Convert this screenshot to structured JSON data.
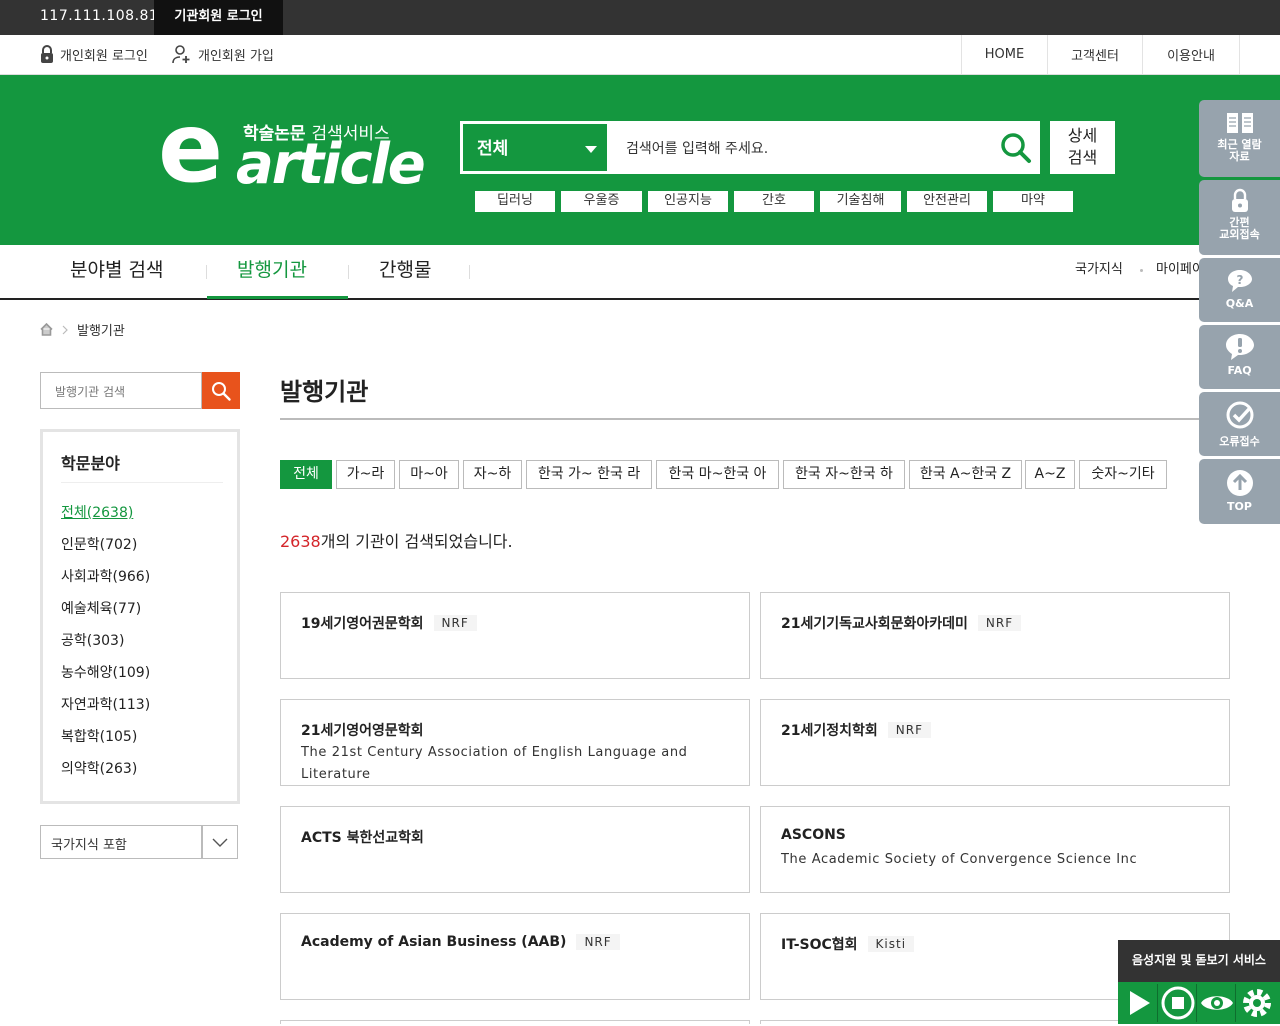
{
  "topbar": {
    "ip": "117.111.108.81",
    "institution_login": "기관회원 로그인"
  },
  "util": {
    "personal_login": "개인회원 로그인",
    "personal_join": "개인회원 가입",
    "home": "HOME",
    "customer_center": "고객센터",
    "usage_guide": "이용안내"
  },
  "header": {
    "logo_sub_bold": "학술논문",
    "logo_sub_rest": "검색서비스",
    "logo_e": "e",
    "logo_word": "article",
    "select_value": "전체",
    "search_placeholder": "검색어를 입력해 주세요.",
    "advanced_line1": "상세",
    "advanced_line2": "검색",
    "keywords": [
      "딥러닝",
      "우울증",
      "인공지능",
      "간호",
      "기술침해",
      "안전관리",
      "마약"
    ]
  },
  "nav": {
    "items": [
      "분야별 검색",
      "발행기관",
      "간행물"
    ],
    "right": [
      "국가지식",
      "마이페이"
    ]
  },
  "breadcrumb": {
    "current": "발행기관"
  },
  "sidebar": {
    "search_placeholder": "발행기관 검색",
    "category_title": "학문분야",
    "categories": [
      "전체(2638)",
      "인문학(702)",
      "사회과학(966)",
      "예술체육(77)",
      "공학(303)",
      "농수해양(109)",
      "자연과학(113)",
      "복합학(105)",
      "의약학(263)"
    ],
    "national_knowledge_select": "국가지식 포함"
  },
  "main": {
    "title": "발행기관",
    "filters": [
      "전체",
      "가~라",
      "마~아",
      "자~하",
      "한국 가~ 한국 라",
      "한국 마~한국 아",
      "한국 자~한국 하",
      "한국 A~한국 Z",
      "A~Z",
      "숫자~기타"
    ],
    "count_number": "2638",
    "count_text": "개의 기관이 검색되었습니다.",
    "cards": [
      {
        "name": "19세기영어권문학회",
        "badge": "NRF",
        "sub": ""
      },
      {
        "name": "21세기기독교사회문화아카데미",
        "badge": "NRF",
        "sub": ""
      },
      {
        "name": "21세기영어영문학회",
        "badge": "",
        "sub": "The 21st Century Association of English Language and Literature"
      },
      {
        "name": "21세기정치학회",
        "badge": "NRF",
        "sub": ""
      },
      {
        "name": "ACTS 북한선교학회",
        "badge": "",
        "sub": ""
      },
      {
        "name": "ASCONS",
        "badge": "",
        "sub": "The Academic Society of Convergence Science Inc"
      },
      {
        "name": "Academy of Asian Business (AAB)",
        "badge": "NRF",
        "sub": ""
      },
      {
        "name": "IT-SOC협회",
        "badge": "Kisti",
        "sub": ""
      }
    ]
  },
  "quick_menu": {
    "recent_line1": "최근 열람",
    "recent_line2": "자료",
    "easy_line1": "간편",
    "easy_line2": "교외접속",
    "qa": "Q&A",
    "faq": "FAQ",
    "error": "오류접수",
    "top": "TOP"
  },
  "voice": {
    "title": "음성지원 및 돋보기 서비스"
  },
  "colors": {
    "brand_green": "#14973f",
    "accent_orange": "#e8531c",
    "count_red": "#d4252a",
    "quick_gray": "#97a3ad"
  }
}
